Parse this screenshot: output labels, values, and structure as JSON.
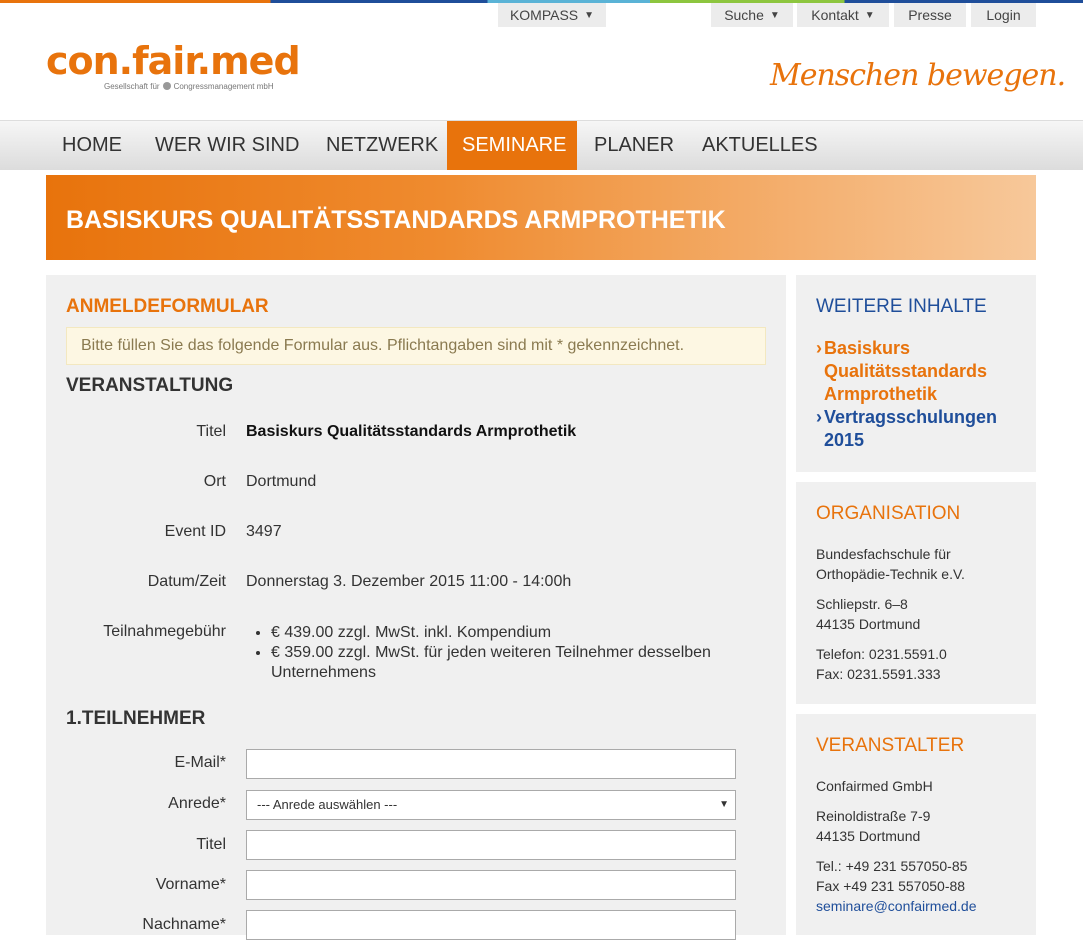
{
  "top_nav": {
    "kompass": "KOMPASS",
    "suche": "Suche",
    "kontakt": "Kontakt",
    "presse": "Presse",
    "login": "Login"
  },
  "logo": {
    "name": "con.fair.med",
    "tagline_left": "Gesellschaft für",
    "tagline_right": "Congressmanagement mbH"
  },
  "slogan": "Menschen bewegen.",
  "main_nav": [
    "HOME",
    "WER WIR SIND",
    "NETZWERK",
    "SEMINARE",
    "PLANER",
    "AKTUELLES"
  ],
  "page_title": "BASISKURS QUALITÄTSSTANDARDS ARMPROTHETIK",
  "form": {
    "heading": "ANMELDEFORMULAR",
    "notice": "Bitte füllen Sie das folgende Formular aus. Pflichtangaben sind mit * gekennzeichnet.",
    "event_heading": "VERANSTALTUNG",
    "event": {
      "titel_label": "Titel",
      "titel": "Basiskurs Qualitätsstandards Armprothetik",
      "ort_label": "Ort",
      "ort": "Dortmund",
      "id_label": "Event ID",
      "id": "3497",
      "datum_label": "Datum/Zeit",
      "datum": "Donnerstag 3. Dezember 2015 11:00 - 14:00h",
      "fee_label": "Teilnahmegebühr",
      "fees": [
        "€ 439.00 zzgl. MwSt. inkl. Kompendium",
        "€ 359.00 zzgl. MwSt. für jeden weiteren Teilnehmer desselben Unternehmens"
      ]
    },
    "participant_heading": "1.TEILNEHMER",
    "fields": {
      "email_label": "E-Mail*",
      "email_value": "",
      "anrede_label": "Anrede*",
      "anrede_selected": "--- Anrede auswählen ---",
      "titel_label": "Titel",
      "titel_value": "",
      "vorname_label": "Vorname*",
      "vorname_value": "",
      "nachname_label": "Nachname*",
      "nachname_value": ""
    }
  },
  "sidebar": {
    "weitere": {
      "heading": "WEITERE INHALTE",
      "links": [
        {
          "line1": "Basiskurs",
          "line2": "Qualitätsstandards",
          "line3": "Armprothetik"
        },
        {
          "line1": "Vertragsschulungen",
          "line2": "2015"
        }
      ]
    },
    "organisation": {
      "heading": "ORGANISATION",
      "name1": "Bundesfachschule für",
      "name2": "Orthopädie-Technik e.V.",
      "street": "Schliepstr. 6–8",
      "city": "44135 Dortmund",
      "tel": "Telefon: 0231.5591.0",
      "fax": "Fax: 0231.5591.333"
    },
    "veranstalter": {
      "heading": "VERANSTALTER",
      "name": "Confairmed GmbH",
      "street": "Reinoldistraße 7-9",
      "city": "44135 Dortmund",
      "tel": "Tel.: +49 231 557050-85",
      "fax": "Fax +49 231 557050-88",
      "email": "seminare@confairmed.de"
    }
  },
  "colors": {
    "brand_orange": "#e8730c",
    "link_blue": "#1f4e9a"
  }
}
